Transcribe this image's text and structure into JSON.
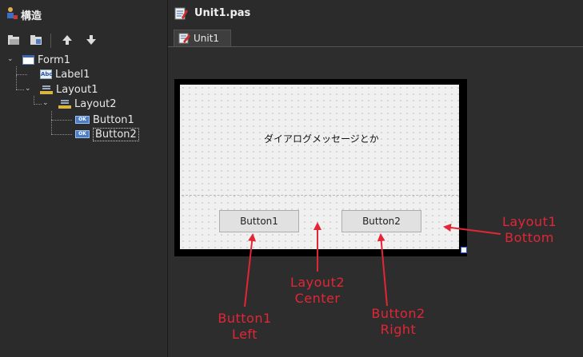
{
  "structure": {
    "title": "構造",
    "tree": [
      {
        "label": "Form1",
        "icon": "form-icon"
      },
      {
        "label": "Label1",
        "icon": "label-icon"
      },
      {
        "label": "Layout1",
        "icon": "layout-icon"
      },
      {
        "label": "Layout2",
        "icon": "layout-icon"
      },
      {
        "label": "Button1",
        "icon": "button-icon"
      },
      {
        "label": "Button2",
        "icon": "button-icon",
        "selected": true
      }
    ]
  },
  "editor": {
    "file_title": "Unit1.pas",
    "tab_label": "Unit1"
  },
  "designer": {
    "label_text": "ダイアログメッセージとか",
    "button1_caption": "Button1",
    "button2_caption": "Button2"
  },
  "annotations": {
    "layout1": [
      "Layout1",
      "Bottom"
    ],
    "layout2": [
      "Layout2",
      "Center"
    ],
    "button1": [
      "Button1",
      "Left"
    ],
    "button2": [
      "Button2",
      "Right"
    ]
  },
  "colors": {
    "annotation": "#e32636",
    "background": "#2b2b2b",
    "selection_handle": "#2a5bd7"
  }
}
